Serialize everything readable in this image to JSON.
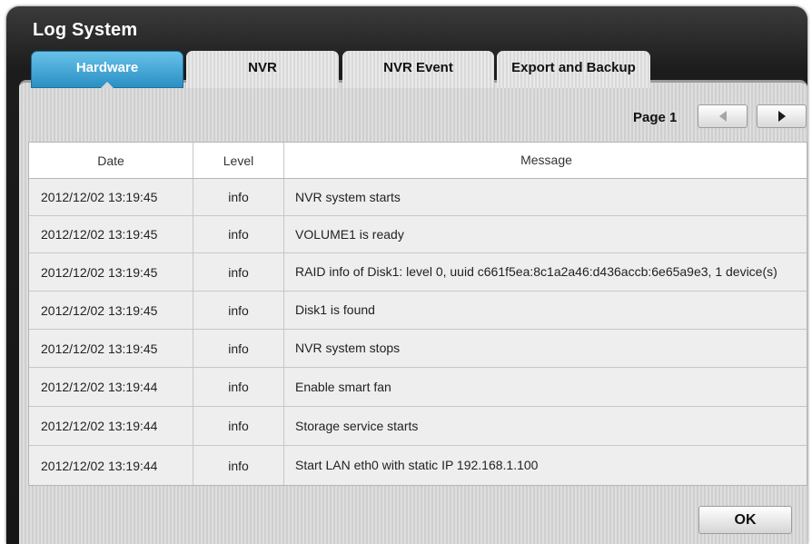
{
  "window": {
    "title": "Log System"
  },
  "tabs": [
    {
      "label": "Hardware",
      "active": true
    },
    {
      "label": "NVR",
      "active": false
    },
    {
      "label": "NVR Event",
      "active": false
    },
    {
      "label": "Export and Backup",
      "active": false
    }
  ],
  "pagination": {
    "page_label": "Page 1",
    "prev_icon": "triangle-left-icon",
    "next_icon": "triangle-right-icon"
  },
  "table": {
    "columns": [
      "Date",
      "Level",
      "Message"
    ],
    "rows": [
      {
        "date": "2012/12/02  13:19:45",
        "level": "info",
        "message": "NVR system starts"
      },
      {
        "date": "2012/12/02  13:19:45",
        "level": "info",
        "message": "VOLUME1 is ready"
      },
      {
        "date": "2012/12/02  13:19:45",
        "level": "info",
        "message": "RAID info of Disk1: level 0, uuid c661f5ea:8c1a2a46:d436accb:6e65a9e3, 1 device(s)"
      },
      {
        "date": "2012/12/02  13:19:45",
        "level": "info",
        "message": "Disk1 is found"
      },
      {
        "date": "2012/12/02  13:19:45",
        "level": "info",
        "message": "NVR system stops"
      },
      {
        "date": "2012/12/02  13:19:44",
        "level": "info",
        "message": "Enable smart fan"
      },
      {
        "date": "2012/12/02  13:19:44",
        "level": "info",
        "message": "Storage service starts"
      },
      {
        "date": "2012/12/02  13:19:44",
        "level": "info",
        "message": "Start LAN eth0 with static IP 192.168.1.100"
      }
    ]
  },
  "footer": {
    "ok_label": "OK"
  },
  "colors": {
    "active_tab": "#2b8fc4",
    "window_bg": "#1c1c1c"
  }
}
